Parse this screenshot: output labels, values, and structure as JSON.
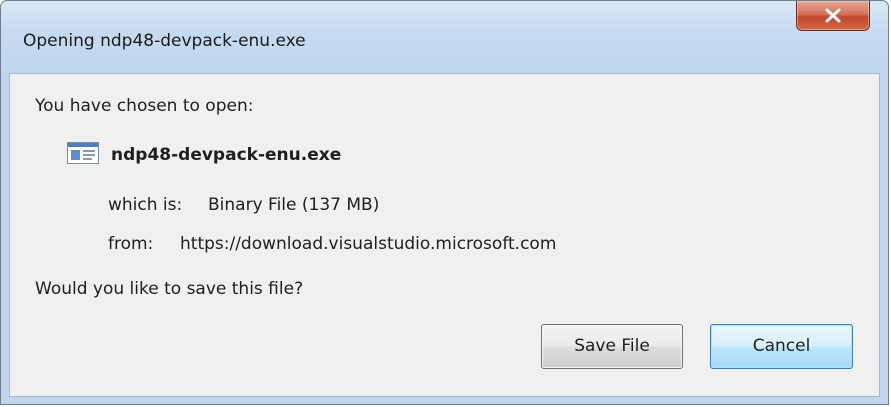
{
  "window": {
    "title": "Opening ndp48-devpack-enu.exe"
  },
  "dialog": {
    "intro": "You have chosen to open:",
    "filename": "ndp48-devpack-enu.exe",
    "file_icon": "file-icon",
    "which_is_label": "which is:",
    "which_is_value": "Binary File (137 MB)",
    "from_label": "from:",
    "from_value": "https://download.visualstudio.microsoft.com",
    "question": "Would you like to save this file?"
  },
  "buttons": {
    "save_label": "Save File",
    "cancel_label": "Cancel"
  },
  "colors": {
    "close_button": "#c1452a",
    "default_button_border": "#3c7fb1",
    "content_bg": "#f0f0f0",
    "title_bg": "#c6dbf1"
  }
}
